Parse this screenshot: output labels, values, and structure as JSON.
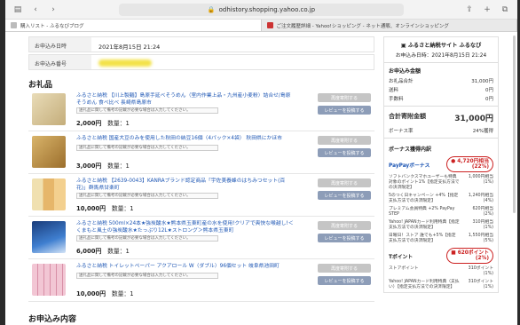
{
  "browser": {
    "url": "odhistory.shopping.yahoo.co.jp",
    "tabs": [
      {
        "label": "購入リスト - ふるなびブログ",
        "active": true
      },
      {
        "label": "ご注文履歴詳細 - Yahoo!ショッピング - ネット通販、オンラインショッピング",
        "active": false
      }
    ]
  },
  "order": {
    "date_label": "お申込み日時",
    "date_value": "2021年8月15日 21:24",
    "number_label": "お申込み番号"
  },
  "gift_title": "お礼品",
  "items": [
    {
      "title": "ふるさと納税 【川上製麺】島原手延べそうめん（室内作業上品・九州産小麦粉）詰合せ/島原そうめん 食べ比べ 長崎県島原市",
      "note": "送礼品に関して備考の記載が必要な場合は入力してください。",
      "price": "2,000円",
      "qty": "数量：1",
      "btn1": "再度寄附する",
      "btn2": "レビューを投稿する",
      "thumb_color": "#d8c9a4"
    },
    {
      "title": "ふるさと納税 国産大豆のみを使用した秋田の納豆16個（4パック×4袋） 秋田県にかほ市",
      "note": "送礼品に関して備考の記載が必要な場合は入力してください。",
      "price": "3,000円",
      "qty": "数量：1",
      "btn1": "再度寄附する",
      "btn2": "レビューを投稿する",
      "thumb_color": "#c9a15a"
    },
    {
      "title": "ふるさと納税 【2639-0043】KANRAブランド認定商品「宇佐美養蜂のはちみつセット(百花)」群馬県甘楽町",
      "note": "送礼品に関して備考の記載が必要な場合は入力してください。",
      "price": "10,000円",
      "qty": "数量：1",
      "btn1": "再度寄附する",
      "btn2": "レビューを投稿する",
      "thumb_color": "#e8c98a"
    },
    {
      "title": "ふるさと納税 500ml×24本★強炭酸水★熊本県玉東町産の水を使用!クリアで爽快な喉越し!＜くまもと風土の強炭酸水★たっぷり12L★ストロング＞熊本県玉東町",
      "note": "送礼品に関して備考の記載が必要な場合は入力してください。",
      "price": "6,000円",
      "qty": "数量：1",
      "btn1": "再度寄附する",
      "btn2": "レビューを投稿する",
      "thumb_color": "#2d4f8a"
    },
    {
      "title": "ふるさと納税 トイレットペーパー アクアロール W（ダブル）96個セット 岐阜県池田町",
      "note": "送礼品に関して備考の記載が必要な場合は入力してください。",
      "price": "10,000円",
      "qty": "数量：1",
      "btn1": "再度寄附する",
      "btn2": "レビューを投稿する",
      "thumb_color": "#e6b8c8"
    }
  ],
  "bottom_title": "お申込み内容",
  "panel": {
    "site": "ふるさと納税サイト ふるなび",
    "date": "お申込み日時：2021年8月15日 21:24",
    "amount_title": "お申込み金額",
    "rows": [
      {
        "label": "お礼品合計",
        "value": "31,000円"
      },
      {
        "label": "送料",
        "value": "0円"
      },
      {
        "label": "手数料",
        "value": "0円"
      }
    ],
    "total_label": "合計寄附金額",
    "total_value": "31,000円",
    "bonus_rate_label": "ボーナス率",
    "bonus_rate_value": "24%獲得",
    "breakdown_title": "ボーナス獲得内訳",
    "paypay_label": "PayPayボーナス",
    "paypay_value": "4,720円相当",
    "paypay_rate": "(22%)",
    "paypay_rows": [
      {
        "label": "ソフトバンクスマホユーザーも特典対象のポイント1%【指定支払方法での決済限定】",
        "value": "1,000円相当",
        "sub": "(1%)"
      },
      {
        "label": "5のつく日キャンペーン +4%【指定支払方法での決済限定】",
        "value": "1,240円相当",
        "sub": "(4%)"
      },
      {
        "label": "プレミアム会員特典 +2% PayPay STEP",
        "value": "620円相当",
        "sub": "(2%)"
      },
      {
        "label": "Yahoo! JAPANカード利用特典【指定支払方法での決済限定】",
        "value": "310円相当",
        "sub": "(1%)"
      },
      {
        "label": "日曜日！ストア 誰でも+5%【指定支払方法での決済限定】",
        "value": "1,550円相当",
        "sub": "(5%)"
      }
    ],
    "tpoint_label": "Tポイント",
    "tpoint_value": "620ポイント",
    "tpoint_rate": "(2%)",
    "tpoint_rows": [
      {
        "label": "ストアポイント",
        "value": "310ポイント",
        "sub": "(1%)"
      },
      {
        "label": "Yahoo! JAPANカード利用特典（支払い）【指定支払方法での決済限定】",
        "value": "310ポイント",
        "sub": "(1%)"
      }
    ]
  }
}
